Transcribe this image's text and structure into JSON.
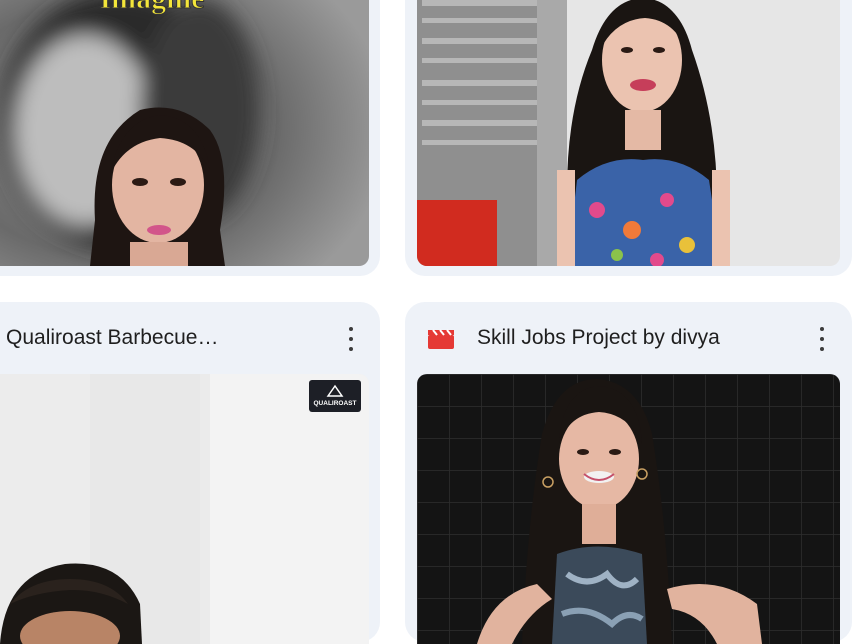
{
  "cards": [
    {
      "title": "",
      "thumbnail_text": "Imagine",
      "icon": ""
    },
    {
      "title": "",
      "thumbnail_text": "",
      "icon": ""
    },
    {
      "title": "Qualiroast Barbecue…",
      "thumbnail_text": "",
      "logo_text": "QUALIROAST",
      "icon": ""
    },
    {
      "title": "Skill Jobs Project by divya",
      "thumbnail_text": "",
      "icon": "film-clapper-icon"
    }
  ],
  "more_icon": "more-vert-icon",
  "colors": {
    "card_bg": "#eef2f8",
    "clapper_red": "#e53935",
    "imagine_yellow": "#f4e63a"
  }
}
